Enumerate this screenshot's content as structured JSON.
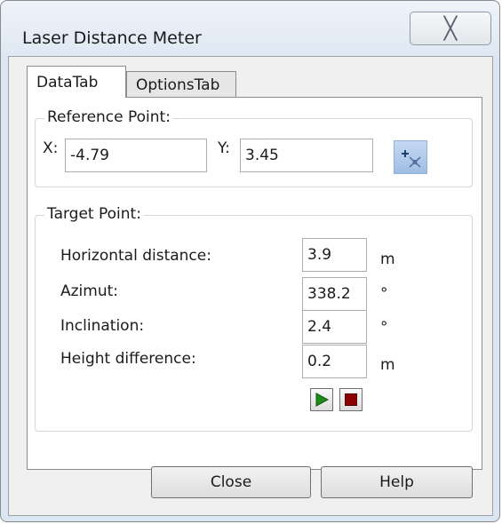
{
  "window": {
    "title": "Laser Distance Meter",
    "close_glyph": "╳"
  },
  "tabs": [
    {
      "label": "DataTab",
      "active": true
    },
    {
      "label": "OptionsTab",
      "active": false
    }
  ],
  "reference_point": {
    "title": "Reference Point:",
    "x_label": "X:",
    "x_value": "-4.79",
    "y_label": "Y:",
    "y_value": "3.45",
    "pick_icon": "crosshair-pick-icon"
  },
  "target_point": {
    "title": "Target Point:",
    "rows": [
      {
        "label": "Horizontal distance:",
        "value": "3.9",
        "unit": "m"
      },
      {
        "label": "Azimut:",
        "value": "338.2",
        "unit": "°"
      },
      {
        "label": "Inclination:",
        "value": "2.4",
        "unit": "°"
      },
      {
        "label": "Height difference:",
        "value": "0.2",
        "unit": "m"
      }
    ],
    "start_icon": "play-icon",
    "stop_icon": "stop-icon",
    "colors": {
      "play": "#1b8a1b",
      "stop": "#8b0000"
    }
  },
  "buttons": {
    "close_label": "Close",
    "help_label": "Help"
  }
}
